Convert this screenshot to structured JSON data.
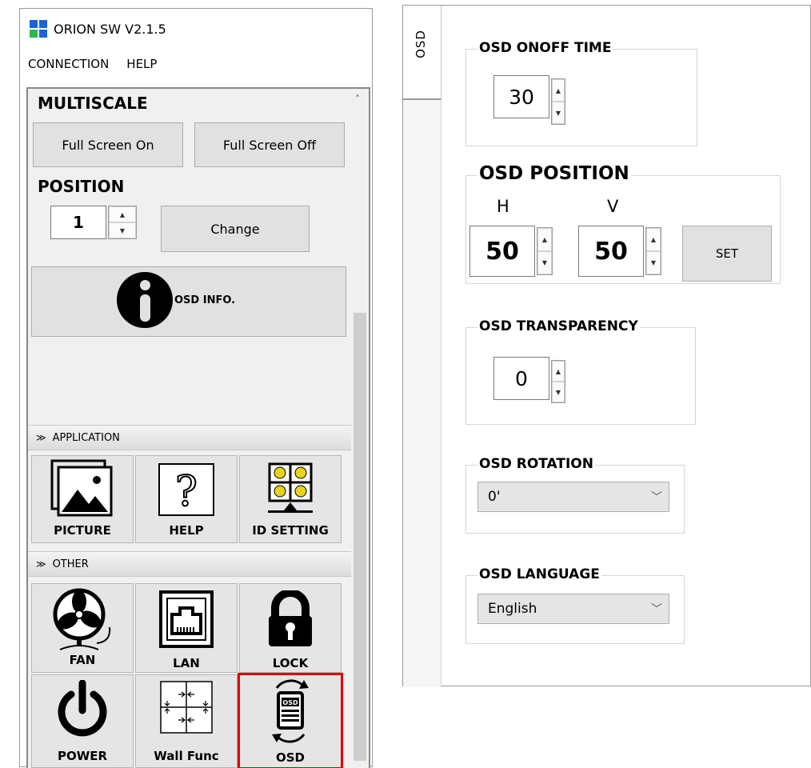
{
  "app": {
    "title": "ORION SW V2.1.5",
    "logo_colors": [
      "#1e63d6",
      "#1e63d6",
      "#2db84a",
      "#1e63d6"
    ]
  },
  "menu": [
    "CONNECTION",
    "HELP"
  ],
  "multiscale": {
    "title": "MULTISCALE",
    "full_on": "Full Screen On",
    "full_off": "Full Screen Off"
  },
  "position": {
    "title": "POSITION",
    "value": "1",
    "change": "Change"
  },
  "osd_info": {
    "label": "OSD INFO."
  },
  "application_group": {
    "header": "APPLICATION",
    "tiles": [
      {
        "label": "PICTURE",
        "icon": "picture-icon"
      },
      {
        "label": "HELP",
        "icon": "question-icon"
      },
      {
        "label": "ID SETTING",
        "icon": "id-setting-icon"
      }
    ]
  },
  "other_group": {
    "header": "OTHER",
    "tiles": [
      {
        "label": "FAN",
        "icon": "fan-icon"
      },
      {
        "label": "LAN",
        "icon": "lan-icon"
      },
      {
        "label": "LOCK",
        "icon": "lock-icon"
      },
      {
        "label": "POWER",
        "icon": "power-icon"
      },
      {
        "label": "Wall Func",
        "icon": "wall-func-icon"
      },
      {
        "label": "OSD",
        "icon": "osd-icon",
        "selected": true
      }
    ]
  },
  "osd_panel": {
    "tab": "OSD",
    "onoff_time": {
      "title": "OSD ONOFF TIME",
      "value": "30"
    },
    "position": {
      "title": "OSD POSITION",
      "h_label": "H",
      "v_label": "V",
      "h_value": "50",
      "v_value": "50",
      "set": "SET"
    },
    "transparency": {
      "title": "OSD TRANSPARENCY",
      "value": "0"
    },
    "rotation": {
      "title": "OSD ROTATION",
      "value": "0'"
    },
    "language": {
      "title": "OSD LANGUAGE",
      "value": "English"
    }
  },
  "colors": {
    "selection": "#e00000",
    "button_bg": "#e1e1e1"
  }
}
